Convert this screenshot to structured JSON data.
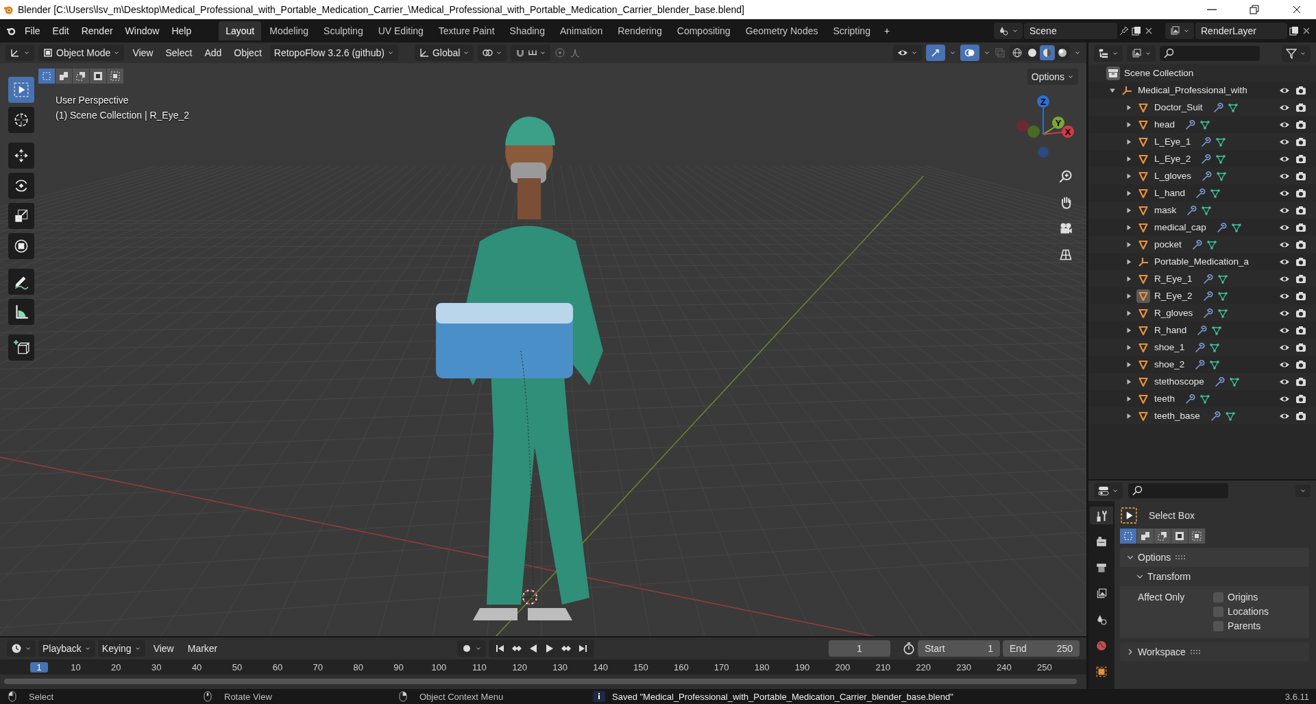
{
  "window": {
    "title": "Blender [C:\\Users\\lsv_m\\Desktop\\Medical_Professional_with_Portable_Medication_Carrier_\\Medical_Professional_with_Portable_Medication_Carrier_blender_base.blend]"
  },
  "menu": [
    "File",
    "Edit",
    "Render",
    "Window",
    "Help"
  ],
  "workspaces": [
    {
      "label": "Layout",
      "selected": true
    },
    {
      "label": "Modeling",
      "selected": false
    },
    {
      "label": "Sculpting",
      "selected": false
    },
    {
      "label": "UV Editing",
      "selected": false
    },
    {
      "label": "Texture Paint",
      "selected": false
    },
    {
      "label": "Shading",
      "selected": false
    },
    {
      "label": "Animation",
      "selected": false
    },
    {
      "label": "Rendering",
      "selected": false
    },
    {
      "label": "Compositing",
      "selected": false
    },
    {
      "label": "Geometry Nodes",
      "selected": false
    },
    {
      "label": "Scripting",
      "selected": false
    }
  ],
  "add_workspace": "+",
  "scene": {
    "name": "Scene"
  },
  "view_layer": {
    "name": "RenderLayer"
  },
  "viewport": {
    "mode": "Object Mode",
    "menus": [
      "View",
      "Select",
      "Add",
      "Object"
    ],
    "addon": "RetopoFlow 3.2.6 (github)",
    "orientation": "Global",
    "shading": [
      {
        "kind": "wireframe",
        "selected": false
      },
      {
        "kind": "solid",
        "selected": false
      },
      {
        "kind": "material",
        "selected": true
      },
      {
        "kind": "rendered",
        "selected": false
      }
    ],
    "options": "Options",
    "select_modes": [
      {
        "kind": "new",
        "selected": true
      },
      {
        "kind": "extend",
        "selected": false
      },
      {
        "kind": "subtract",
        "selected": false
      },
      {
        "kind": "invert",
        "selected": false
      },
      {
        "kind": "intersect",
        "selected": false
      }
    ],
    "tools": [
      {
        "kind": "select-box",
        "selected": true
      },
      {
        "kind": "cursor",
        "selected": false
      },
      {
        "kind": "move",
        "selected": false
      },
      {
        "kind": "rotate",
        "selected": false
      },
      {
        "kind": "scale",
        "selected": false
      },
      {
        "kind": "transform",
        "selected": false
      },
      {
        "kind": "annotate",
        "selected": false
      },
      {
        "kind": "measure",
        "selected": false
      },
      {
        "kind": "add-cube",
        "selected": false
      }
    ],
    "overlay_text": [
      "User Perspective",
      "(1) Scene Collection | R_Eye_2"
    ],
    "gizmo": {
      "x": "X",
      "y": "Y",
      "z": "Z"
    }
  },
  "outliner": {
    "root": "Scene Collection",
    "items": [
      {
        "name": "Medical_Professional_with",
        "kind": "empty",
        "expanded": true,
        "active": false,
        "children": [
          {
            "name": "Doctor_Suit",
            "kind": "mesh",
            "expanded": false,
            "active": false
          },
          {
            "name": "head",
            "kind": "mesh",
            "expanded": false,
            "active": false
          },
          {
            "name": "L_Eye_1",
            "kind": "mesh",
            "expanded": false,
            "active": false
          },
          {
            "name": "L_Eye_2",
            "kind": "mesh",
            "expanded": false,
            "active": false
          },
          {
            "name": "L_gloves",
            "kind": "mesh",
            "expanded": false,
            "active": false
          },
          {
            "name": "L_hand",
            "kind": "mesh",
            "expanded": false,
            "active": false
          },
          {
            "name": "mask",
            "kind": "mesh",
            "expanded": false,
            "active": false
          },
          {
            "name": "medical_cap",
            "kind": "mesh",
            "expanded": false,
            "active": false
          },
          {
            "name": "pocket",
            "kind": "mesh",
            "expanded": false,
            "active": false
          },
          {
            "name": "Portable_Medication_a",
            "kind": "empty",
            "expanded": false,
            "active": false
          },
          {
            "name": "R_Eye_1",
            "kind": "mesh",
            "expanded": false,
            "active": false
          },
          {
            "name": "R_Eye_2",
            "kind": "mesh",
            "expanded": false,
            "active": true
          },
          {
            "name": "R_gloves",
            "kind": "mesh",
            "expanded": false,
            "active": false
          },
          {
            "name": "R_hand",
            "kind": "mesh",
            "expanded": false,
            "active": false
          },
          {
            "name": "shoe_1",
            "kind": "mesh",
            "expanded": false,
            "active": false
          },
          {
            "name": "shoe_2",
            "kind": "mesh",
            "expanded": false,
            "active": false
          },
          {
            "name": "stethoscope",
            "kind": "mesh",
            "expanded": false,
            "active": false
          },
          {
            "name": "teeth",
            "kind": "mesh",
            "expanded": false,
            "active": false
          },
          {
            "name": "teeth_base",
            "kind": "mesh",
            "expanded": false,
            "active": false
          }
        ]
      }
    ]
  },
  "properties": {
    "tabs": [
      {
        "kind": "tool",
        "selected": true
      },
      {
        "kind": "render",
        "selected": false
      },
      {
        "kind": "output",
        "selected": false
      },
      {
        "kind": "view-layer",
        "selected": false
      },
      {
        "kind": "scene",
        "selected": false
      },
      {
        "kind": "world",
        "selected": false
      },
      {
        "kind": "object",
        "selected": false
      }
    ],
    "tool": "Select Box",
    "select_modes": [
      {
        "kind": "new",
        "selected": true
      },
      {
        "kind": "extend",
        "selected": false
      },
      {
        "kind": "subtract",
        "selected": false
      },
      {
        "kind": "invert",
        "selected": false
      },
      {
        "kind": "intersect",
        "selected": false
      }
    ],
    "panels": [
      {
        "title": "Options",
        "expanded": true,
        "subpanel": {
          "title": "Transform",
          "expanded": true,
          "label": "Affect Only",
          "options": [
            {
              "label": "Origins",
              "checked": false
            },
            {
              "label": "Locations",
              "checked": false
            },
            {
              "label": "Parents",
              "checked": false
            }
          ]
        }
      },
      {
        "title": "Workspace",
        "expanded": false
      }
    ]
  },
  "timeline": {
    "menus": [
      {
        "label": "Playback",
        "dropdown": true
      },
      {
        "label": "Keying",
        "dropdown": true
      },
      {
        "label": "View",
        "dropdown": false
      },
      {
        "label": "Marker",
        "dropdown": false
      }
    ],
    "current_frame": "1",
    "start_label": "Start",
    "start": "1",
    "end_label": "End",
    "end": "250",
    "ruler": [
      {
        "label": "1",
        "selected": true
      },
      {
        "label": "10",
        "selected": false
      },
      {
        "label": "20",
        "selected": false
      },
      {
        "label": "30",
        "selected": false
      },
      {
        "label": "40",
        "selected": false
      },
      {
        "label": "50",
        "selected": false
      },
      {
        "label": "60",
        "selected": false
      },
      {
        "label": "70",
        "selected": false
      },
      {
        "label": "80",
        "selected": false
      },
      {
        "label": "90",
        "selected": false
      },
      {
        "label": "100",
        "selected": false
      },
      {
        "label": "110",
        "selected": false
      },
      {
        "label": "120",
        "selected": false
      },
      {
        "label": "130",
        "selected": false
      },
      {
        "label": "140",
        "selected": false
      },
      {
        "label": "150",
        "selected": false
      },
      {
        "label": "160",
        "selected": false
      },
      {
        "label": "170",
        "selected": false
      },
      {
        "label": "180",
        "selected": false
      },
      {
        "label": "190",
        "selected": false
      },
      {
        "label": "200",
        "selected": false
      },
      {
        "label": "210",
        "selected": false
      },
      {
        "label": "220",
        "selected": false
      },
      {
        "label": "230",
        "selected": false
      },
      {
        "label": "240",
        "selected": false
      },
      {
        "label": "250",
        "selected": false
      }
    ]
  },
  "status_bar": {
    "hints": [
      {
        "kind": "left-click",
        "label": "Select"
      },
      {
        "kind": "middle-click",
        "label": "Rotate View"
      },
      {
        "kind": "right-click",
        "label": "Object Context Menu"
      }
    ],
    "message": "Saved \"Medical_Professional_with_Portable_Medication_Carrier_blender_base.blend\"",
    "version": "3.6.11"
  }
}
